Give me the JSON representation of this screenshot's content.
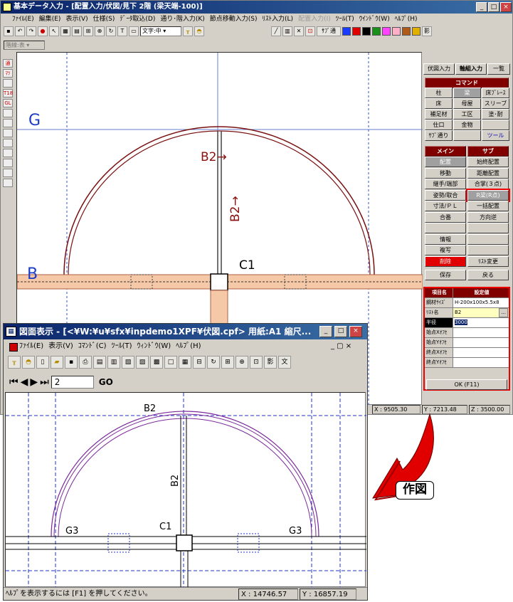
{
  "main_window": {
    "title": "基本データ入力 - [配置入力/伏図/見下 2階 (梁天端-100)]",
    "menus": [
      "ﾌｧｲﾙ(E)",
      "編集(E)",
      "表示(V)",
      "仕様(S)",
      "ﾃﾞｰﾀ取込(D)",
      "通り･階入力(K)",
      "節点移動入力(S)",
      "ﾘｽﾄ入力(L)",
      "配置入力(I)",
      "ﾂｰﾙ(T)",
      "ｳｲﾝﾄﾞｳ(W)",
      "ﾍﾙﾌﾟ(H)"
    ],
    "disabled_menu_index": 8,
    "toolbar": {
      "text_label": "文字:中",
      "sub_label": "ｻﾌﾞ通"
    },
    "layer_select": "階線:表",
    "swatch_colors": [
      "#1a3cff",
      "#e00000",
      "#000000",
      "#1a8f1a",
      "#ff44ff",
      "#ffb0c8",
      "#b05a1a",
      "#e0b000"
    ],
    "left_tools": [
      "通",
      "ﾏﾂ",
      "",
      "T18",
      "GL",
      "",
      "",
      "",
      "",
      "",
      "",
      "",
      ""
    ],
    "drawing": {
      "grid_g": "G",
      "grid_b": "B",
      "beam_b2_top": "B2→",
      "beam_b2_vertical": "B2→",
      "column_label": "C1"
    },
    "coords": {
      "x": "X : 9505.30",
      "y": "Y : 7213.48",
      "z": "Z : 3500.00"
    }
  },
  "panel": {
    "tabs": [
      "伏図入力",
      "軸組入力",
      "一覧"
    ],
    "command_header": "コマンド",
    "commands": [
      "柱",
      "梁",
      "床ﾌﾞﾚｰｽ",
      "床",
      "母屋",
      "スリーブ",
      "補足材",
      "工区",
      "塗･耐",
      "仕口",
      "金物",
      "",
      "ｻﾌﾞ通り",
      "",
      "ツール"
    ],
    "main_header": "メイン",
    "sub_header": "サブ",
    "main_items": [
      "配置",
      "移動",
      "継手/端部",
      "姿勢/取合",
      "寸法/ＰＬ",
      "合番",
      "",
      "情報",
      "複写",
      "削除"
    ],
    "sub_items": [
      "始終配置",
      "距離配置",
      "合掌(３点)",
      "R梁(R点)",
      "一括配置",
      "方向逆",
      "",
      "",
      "",
      "ﾘｽﾄ変更"
    ],
    "save_label": "保存",
    "back_label": "戻る",
    "prop_header_name": "項目名",
    "prop_header_value": "設定値",
    "props": [
      {
        "key": "鋼材ｻｲｽﾞ",
        "value": "H-200x100x5.5x8"
      },
      {
        "key": "ﾘｽﾄ名",
        "value": "B2"
      },
      {
        "key": "半径",
        "value": "3000"
      },
      {
        "key": "始点Xｵﾌｾ",
        "value": ""
      },
      {
        "key": "始点Yｵﾌｾ",
        "value": ""
      },
      {
        "key": "終点Xｵﾌｾ",
        "value": ""
      },
      {
        "key": "終点Yｵﾌｾ",
        "value": ""
      }
    ],
    "ok_label": "OK (F11)"
  },
  "preview_window": {
    "title": "図面表示 - [<¥W:¥u¥sfx¥inpdemo1XPF¥伏図.cpf> 用紙:A1 縮尺...",
    "menus": [
      "ﾌｧｲﾙ(E)",
      "表示(V)",
      "ｺﾏﾝﾄﾞ(C)",
      "ﾂｰﾙ(T)",
      "ｳｨﾝﾄﾞｳ(W)",
      "ﾍﾙﾌﾟ(H)"
    ],
    "page_number": "2",
    "go_label": "GO",
    "shadow_label": "影",
    "text_label": "文",
    "drawing": {
      "top_label": "B2",
      "vertical_label": "B2",
      "column_label": "C1",
      "left_label": "G3",
      "right_label": "G3"
    },
    "status": "ﾍﾙﾌﾟを表示するには [F1] を押してください。",
    "x": "X : 14746.57",
    "y": "Y : 16857.19"
  },
  "callout_label": "作図"
}
